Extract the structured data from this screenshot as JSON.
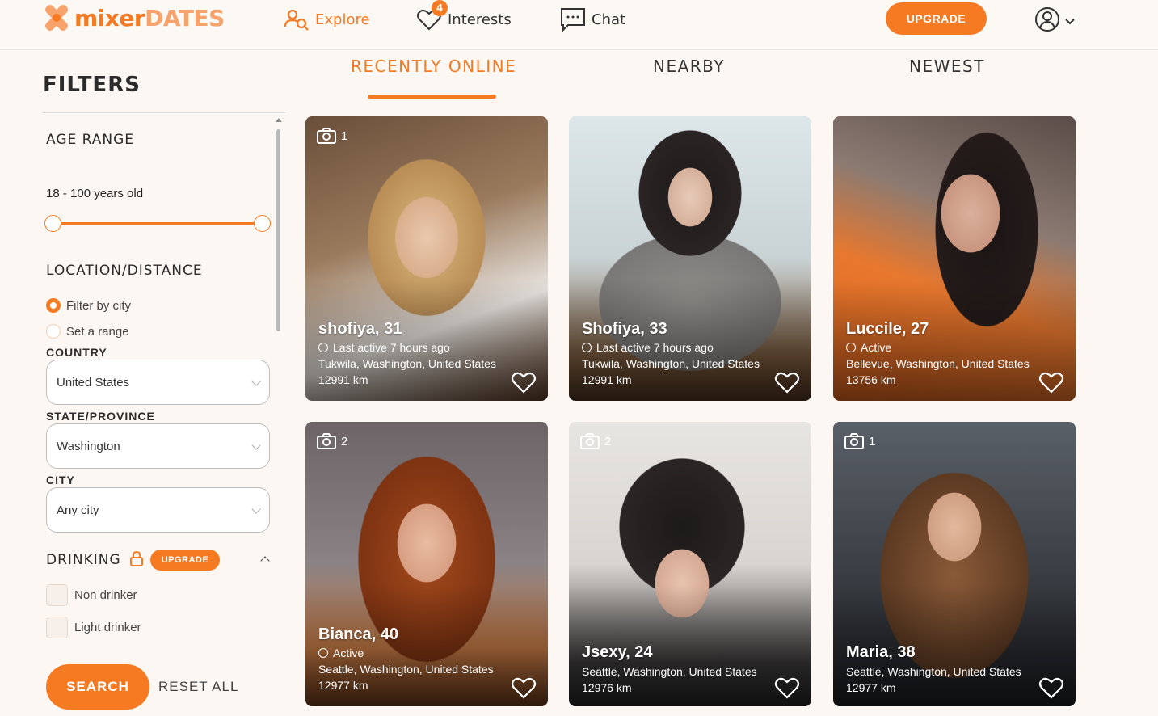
{
  "brand": {
    "part1": "mixer",
    "part2": "DATES",
    "color": "#f57a22"
  },
  "nav": {
    "explore": "Explore",
    "interests": "Interests",
    "interests_badge": "4",
    "chat": "Chat",
    "upgrade": "UPGRADE"
  },
  "filters": {
    "title": "FILTERS",
    "age_range_heading": "AGE RANGE",
    "age_range_text": "18 - 100 years old",
    "age_min": 18,
    "age_max": 100,
    "location_heading": "LOCATION/DISTANCE",
    "filter_by_city": "Filter by city",
    "set_range": "Set a range",
    "country_label": "COUNTRY",
    "country_value": "United States",
    "state_label": "STATE/PROVINCE",
    "state_value": "Washington",
    "city_label": "CITY",
    "city_value": "Any city",
    "drinking_heading": "DRINKING",
    "drinking_upgrade": "UPGRADE",
    "drinking_options": [
      "Non drinker",
      "Light drinker"
    ],
    "search": "SEARCH",
    "reset": "RESET ALL"
  },
  "tabs": [
    "RECENTLY ONLINE",
    "NEARBY",
    "NEWEST"
  ],
  "profiles": [
    {
      "name": "shofiya, 31",
      "photos": "1",
      "status": "Last active 7 hours ago",
      "location": "Tukwila, Washington, United States",
      "distance": "12991 km"
    },
    {
      "name": "Shofiya, 33",
      "photos": "",
      "status": "Last active 7 hours ago",
      "location": "Tukwila, Washington, United States",
      "distance": "12991 km"
    },
    {
      "name": "Luccile, 27",
      "photos": "",
      "status": "Active",
      "location": "Bellevue, Washington, United States",
      "distance": "13756 km"
    },
    {
      "name": "Bianca, 40",
      "photos": "2",
      "status": "Active",
      "location": "Seattle, Washington, United States",
      "distance": "12977 km"
    },
    {
      "name": "Jsexy, 24",
      "photos": "2",
      "status": "",
      "location": "Seattle, Washington, United States",
      "distance": "12976 km"
    },
    {
      "name": "Maria, 38",
      "photos": "1",
      "status": "",
      "location": "Seattle, Washington, United States",
      "distance": "12977 km"
    }
  ]
}
